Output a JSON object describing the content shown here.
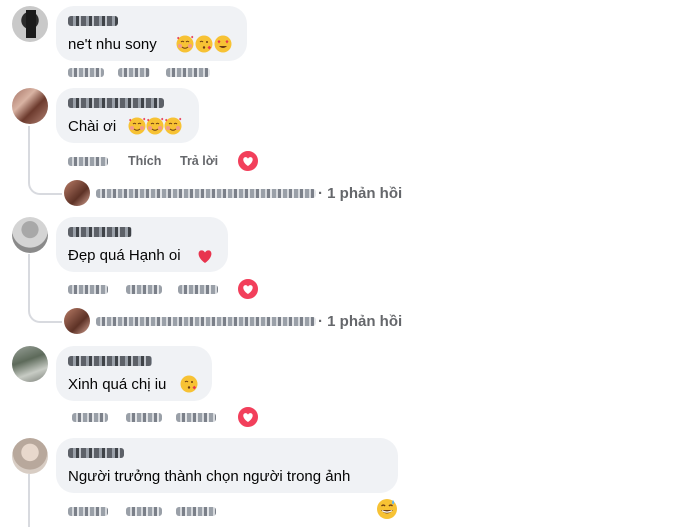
{
  "comments": [
    {
      "text": "ne't nhu sony",
      "emoji_icons": [
        "smiling-face-hearts-icon",
        "face-blowing-kiss-icon",
        "heart-eyes-icon"
      ]
    },
    {
      "text": "Chài ơi",
      "emoji_icons": [
        "smiling-face-hearts-icon",
        "smiling-face-hearts-icon",
        "smiling-face-hearts-icon"
      ],
      "actions": {
        "like": "Thích",
        "reply": "Trả lời"
      },
      "reactions": [
        "heart-reaction-icon"
      ],
      "reply_summary": "· 1 phản hồi"
    },
    {
      "text": "Đẹp quá Hạnh oi",
      "emoji_icons": [
        "red-heart-icon"
      ],
      "reactions": [
        "heart-reaction-icon"
      ],
      "reply_summary": "· 1 phản hồi"
    },
    {
      "text": "Xinh quá chị iu",
      "emoji_icons": [
        "face-blowing-kiss-icon"
      ],
      "reactions": [
        "heart-reaction-icon"
      ]
    },
    {
      "text": "Người trưởng thành chọn người trong ảnh",
      "emoji_icons": [
        "grinning-sweat-icon"
      ]
    }
  ],
  "colors": {
    "bubble": "#f0f2f5",
    "secondary_text": "#65676b",
    "heart": "#f23f5b",
    "thread_line": "#d8dadf"
  }
}
